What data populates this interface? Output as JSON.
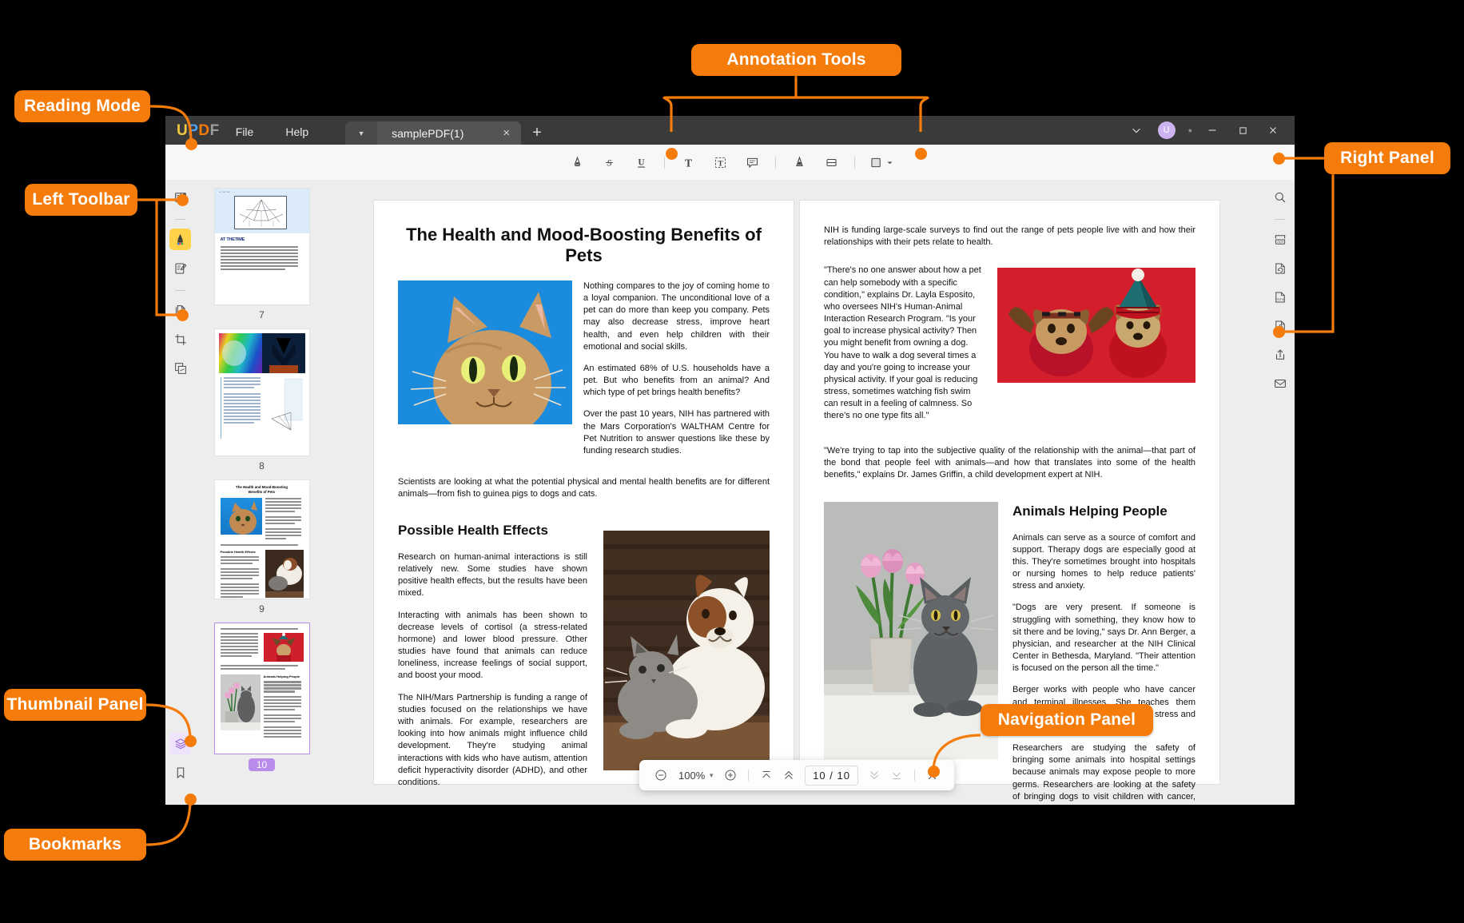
{
  "annotations": {
    "reading_mode": "Reading Mode",
    "left_toolbar": "Left Toolbar",
    "thumbnail_panel": "Thumbnail Panel",
    "bookmarks": "Bookmarks",
    "annotation_tools": "Annotation Tools",
    "right_panel": "Right Panel",
    "navigation_panel": "Navigation Panel",
    "accent_color": "#F57C0B"
  },
  "titlebar": {
    "logo": "UPDF",
    "logo_letters": [
      "U",
      "P",
      "D",
      "F"
    ],
    "menus": [
      "File",
      "Help"
    ],
    "tab_chevron": "chevron-down-icon",
    "tab_label": "samplePDF(1)",
    "tab_close": "×",
    "new_tab": "+",
    "account_initial": "U",
    "window_chevron": "⌄",
    "minimize": "—",
    "maximize": "□",
    "close": "✕"
  },
  "toolbar": {
    "tools": [
      {
        "name": "highlight-tool",
        "glyph": "▲",
        "label": "Highlight"
      },
      {
        "name": "strikethrough-tool",
        "glyph": "S",
        "label": "Strikethrough"
      },
      {
        "name": "underline-tool",
        "glyph": "U",
        "label": "Underline"
      },
      {
        "name": "text-tool",
        "glyph": "T",
        "label": "Text"
      },
      {
        "name": "text-box-tool",
        "glyph": "T",
        "label": "Text Box"
      },
      {
        "name": "sticky-note-tool",
        "glyph": "▤",
        "label": "Sticky Note"
      },
      {
        "name": "pencil-tool",
        "glyph": "▲",
        "label": "Pencil"
      },
      {
        "name": "eraser-tool",
        "glyph": "▤",
        "label": "Eraser"
      },
      {
        "name": "shape-tool",
        "glyph": "□",
        "label": "Shapes"
      }
    ]
  },
  "left_rail": {
    "items": [
      {
        "name": "reading-mode-icon",
        "label": "Reading Mode",
        "state": "normal"
      },
      {
        "name": "comment-highlight-icon",
        "label": "Comment",
        "state": "active"
      },
      {
        "name": "edit-pdf-icon",
        "label": "Edit PDF",
        "state": "normal"
      },
      {
        "name": "page-icon",
        "label": "Organize Pages",
        "state": "normal"
      },
      {
        "name": "crop-icon",
        "label": "Crop",
        "state": "normal"
      },
      {
        "name": "batch-icon",
        "label": "Batch Process",
        "state": "normal"
      }
    ],
    "bottom_items": [
      {
        "name": "layers-icon",
        "label": "Layers",
        "state": "active"
      },
      {
        "name": "bookmark-icon",
        "label": "Bookmarks",
        "state": "normal"
      }
    ]
  },
  "right_rail": {
    "items": [
      {
        "name": "search-icon",
        "label": "Search"
      },
      {
        "name": "ocr-icon",
        "label": "OCR"
      },
      {
        "name": "convert-icon",
        "label": "Convert"
      },
      {
        "name": "pdfa-icon",
        "label": "PDF/A"
      },
      {
        "name": "protect-icon",
        "label": "Protect"
      },
      {
        "name": "share-icon",
        "label": "Share"
      },
      {
        "name": "email-icon",
        "label": "Email"
      }
    ]
  },
  "thumbnails": {
    "items": [
      {
        "number": "7",
        "selected": false,
        "title": "AT THETIME"
      },
      {
        "number": "8",
        "selected": false,
        "title": ""
      },
      {
        "number": "9",
        "selected": false,
        "title": "The Health and Mood-Boosting Benefits of Pets"
      },
      {
        "number": "10",
        "selected": true,
        "title": "Animals Helping People"
      }
    ]
  },
  "navbar": {
    "zoom_out": "⊖",
    "zoom_level": "100%",
    "zoom_in": "⊕",
    "first_page": "first-page-icon",
    "prev_page": "prev-page-icon",
    "page_indicator": "10 / 10",
    "current_page": "10",
    "total_pages": "10",
    "next_page": "next-page-icon",
    "last_page": "last-page-icon",
    "close": "✕"
  },
  "document": {
    "left_page": {
      "title": "The Health and Mood-Boosting Benefits of Pets",
      "paragraphs": [
        "Nothing compares to the joy of coming home to a loyal companion. The unconditional love of a pet can do more than keep you company. Pets may also decrease stress, improve heart health, and even help children with their emotional and social skills.",
        "An estimated 68% of U.S. households have a pet. But who benefits from an animal? And which type of pet brings health benefits?",
        "Over the past 10 years, NIH has partnered with the Mars Corporation's WALTHAM Centre for Pet Nutrition to answer questions like these by funding research studies."
      ],
      "full_width_paragraph": "Scientists are looking at what the potential physical and mental health benefits are for different animals—from fish to guinea pigs to dogs and cats.",
      "section_heading": "Possible Health Effects",
      "section_paragraphs": [
        "Research on human-animal interactions is still relatively new. Some studies have shown positive health effects, but the results have been mixed.",
        "Interacting with animals has been shown to decrease levels of cortisol (a stress-related hormone) and lower blood pressure. Other studies have found that animals can reduce loneliness, increase feelings of social support, and boost your mood.",
        "The NIH/Mars Partnership is funding a range of studies focused on the relationships we have with animals. For example, researchers are looking into how animals might influence child development. They're studying animal interactions with kids who have autism, attention deficit hyperactivity disorder (ADHD), and other conditions."
      ],
      "image_alt_1": "orange tabby cat on blue background",
      "image_alt_2": "dog and cat resting together"
    },
    "right_page": {
      "intro": "NIH is funding large-scale surveys to find out the range of pets people live with and how their relationships with their pets relate to health.",
      "quote_paragraph": "\"There's no one answer about how a pet can help somebody with a  specific condition,\" explains Dr. Layla Esposito, who oversees NIH's Human-Animal  Interaction Research Program. \"Is your goal to increase physical activity? Then you might benefit from owning a dog. You have to walk a dog several times a day and you're going to increase your physical activity.  If your goal is reducing stress, sometimes watching fish swim can result in a feeling of calmness. So there's no one type fits all.\"",
      "griffin_quote": "\"We're trying to tap into the subjective quality of the relationship with the animal—that part of the bond that people feel with animals—and how that translates into some of the health benefits,\" explains Dr. James Griffin, a child development expert at NIH.",
      "section_heading": "Animals Helping People",
      "section_paragraphs": [
        "Animals can serve as a source of comfort and support. Therapy dogs are especially good at this. They're sometimes brought into hospitals or nursing homes to help reduce patients' stress and anxiety.",
        "\"Dogs are very present. If someone is struggling with something, they know how to sit there and be loving,\"  says  Dr.  Ann Berger,  a  physician, and researcher at the NIH Clinical Center in Bethesda, Maryland. \"Their  attention  is  focused  on  the person all the time.\"",
        "Berger works with people who have cancer and terminal illnesses.  She  teaches  them about mindfulness to help decrease stress and manage pain.",
        "Researchers are studying the safety of bringing some animals into hospital settings because animals may expose people to more germs. Researchers are looking at the safety of bringing dogs to visit children with cancer,  Esposito says. Scientists will be testing the children's hands to see if there are dangerous levels of  germs transferred from the dog after the visit."
      ],
      "image_alt_1": "two dogs in festive holiday costumes on red background",
      "image_alt_2": "grey cat beside a vase of tulips"
    }
  }
}
